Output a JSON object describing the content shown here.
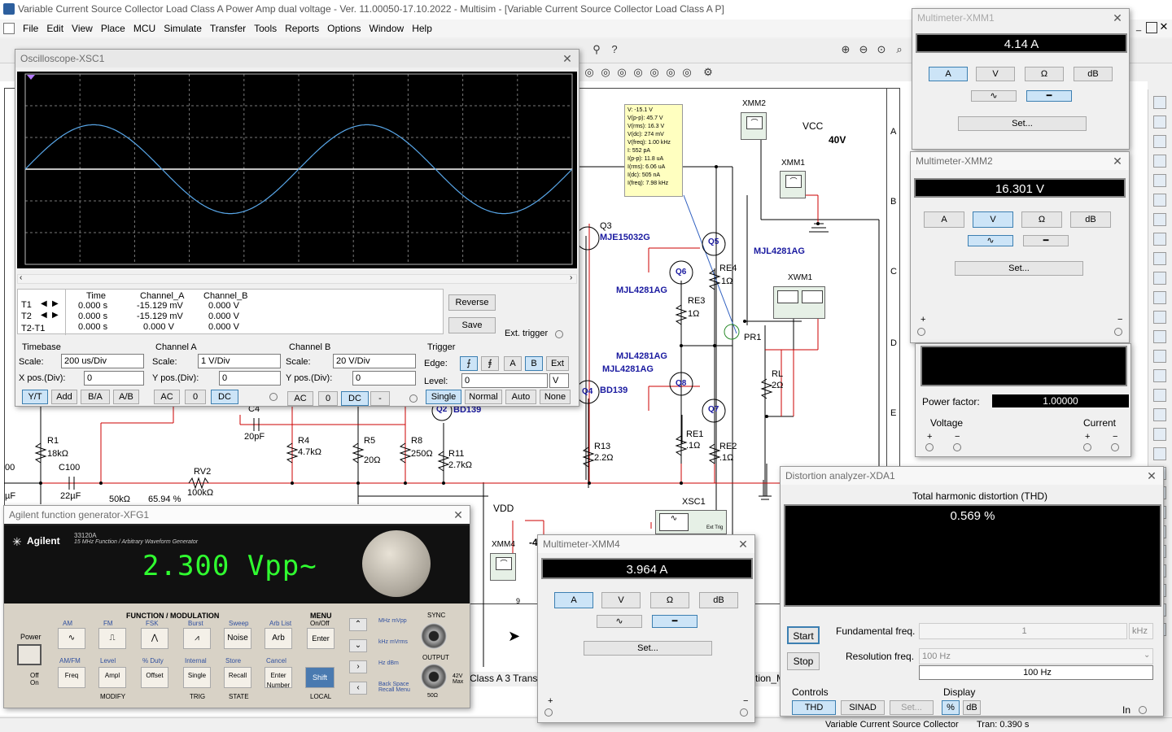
{
  "app": {
    "title": "Variable Current Source Collector Load Class A Power Amp dual voltage - Ver. 11.00050-17.10.2022 - Multisim - [Variable Current Source Collector Load Class A P]",
    "menu": [
      "File",
      "Edit",
      "View",
      "Place",
      "MCU",
      "Simulate",
      "Transfer",
      "Tools",
      "Reports",
      "Options",
      "Window",
      "Help"
    ],
    "status_doc": "Variable Current Source Collector",
    "status_tran": "Tran: 0.390 s",
    "tab1": "Class A 3 Transis",
    "tab2": "tion_M",
    "selected_tab_icon": "scissors-icon"
  },
  "probe": {
    "lines": [
      "V: -15.1 V",
      "V(p-p): 45.7 V",
      "V(rms): 16.3 V",
      "V(dc): 274 mV",
      "V(freq): 1.00 kHz",
      "I: 552 pA",
      "I(p-p): 11.8 uA",
      "I(rms): 6.06 uA",
      "I(dc): 505 nA",
      "I(freq): 7.98 kHz"
    ]
  },
  "schematic": {
    "labels": {
      "xmm2": "XMM2",
      "vcc": "VCC",
      "v40": "40V",
      "xmm1": "XMM1",
      "q3": "Q3",
      "q3_part": "MJE15032G",
      "q5": "Q5",
      "q6": "Q6",
      "mjl1": "MJL4281AG",
      "mjl2": "MJL4281AG",
      "mjl3": "MJL4281AG",
      "mjl4": "MJL4281AG",
      "re4": "RE4",
      "re4v": "1Ω",
      "re3": "RE3",
      "re3v": "1Ω",
      "xwm1": "XWM1",
      "pr1": "PR1",
      "rl": "RL",
      "rlv": "2Ω",
      "q4": "Q4",
      "q4_part": "BD139",
      "q8": "Q8",
      "q7": "Q7",
      "q2": "Q2",
      "q2_part": "BD139",
      "re1": "RE1",
      "re1v": ".1Ω",
      "re2": "RE2",
      "re2v": ".1Ω",
      "r13": "R13",
      "r13v": "2.2Ω",
      "r1": "R1",
      "r1v": "18kΩ",
      "c100": "C100",
      "c100v": "22µF",
      "c4": "C4",
      "c4v": "20pF",
      "r4": "R4",
      "r4v": "4.7kΩ",
      "r5": "R5",
      "r5v": "20Ω",
      "r8": "R8",
      "r8v": "250Ω",
      "r11": "R11",
      "r11v": "2.7kΩ",
      "rv2": "RV2",
      "rv2v": "100kΩ",
      "pot50": "50kΩ",
      "pct": "65.94 %",
      "xsc1": "XSC1",
      "vdd": "VDD",
      "xmm4": "XMM4",
      "row_a": "A",
      "row_b": "B",
      "row_c": "C",
      "row_d": "D",
      "row_e": "E",
      "col9": "9",
      "left00": "00",
      "leftuF": "µF",
      "neg4": "-4",
      "ext_trig": "Ext Trig"
    }
  },
  "oscilloscope": {
    "title": "Oscilloscope-XSC1",
    "cols": [
      "Time",
      "Channel_A",
      "Channel_B"
    ],
    "rows": [
      {
        "name": "T1",
        "time": "0.000 s",
        "a": "-15.129 mV",
        "b": "0.000 V"
      },
      {
        "name": "T2",
        "time": "0.000 s",
        "a": "-15.129 mV",
        "b": "0.000 V"
      },
      {
        "name": "T2-T1",
        "time": "0.000 s",
        "a": "0.000 V",
        "b": "0.000 V"
      }
    ],
    "reverse": "Reverse",
    "save": "Save",
    "ext_trigger": "Ext. trigger",
    "timebase": {
      "title": "Timebase",
      "scale_label": "Scale:",
      "scale": "200 us/Div",
      "xpos_label": "X pos.(Div):",
      "xpos": "0",
      "modes": [
        "Y/T",
        "Add",
        "B/A",
        "A/B"
      ]
    },
    "chA": {
      "title": "Channel A",
      "scale_label": "Scale:",
      "scale": "1  V/Div",
      "ypos_label": "Y pos.(Div):",
      "ypos": "0",
      "coupling": [
        "AC",
        "0",
        "DC"
      ]
    },
    "chB": {
      "title": "Channel B",
      "scale_label": "Scale:",
      "scale": "20  V/Div",
      "ypos_label": "Y pos.(Div):",
      "ypos": "0",
      "coupling": [
        "AC",
        "0",
        "DC",
        "-"
      ]
    },
    "trigger": {
      "title": "Trigger",
      "edge_label": "Edge:",
      "sources": [
        "A",
        "B",
        "Ext"
      ],
      "level_label": "Level:",
      "level": "0",
      "level_unit": "V",
      "modes": [
        "Single",
        "Normal",
        "Auto",
        "None"
      ]
    },
    "waveform": {
      "amplitude_div": 1.4,
      "cycles": 2.0,
      "phase_deg": 0
    }
  },
  "xmm1": {
    "title": "Multimeter-XMM1",
    "value": "4.14 A",
    "modes": [
      "A",
      "V",
      "Ω",
      "dB"
    ],
    "set": "Set...",
    "mode_sel": "A",
    "ac_dc_sel": "dc"
  },
  "xmm2": {
    "title": "Multimeter-XMM2",
    "value": "16.301 V",
    "modes": [
      "A",
      "V",
      "Ω",
      "dB"
    ],
    "set": "Set...",
    "mode_sel": "V",
    "ac_dc_sel": "ac"
  },
  "xmm4": {
    "title": "Multimeter-XMM4",
    "value": "3.964 A",
    "modes": [
      "A",
      "V",
      "Ω",
      "dB"
    ],
    "set": "Set...",
    "mode_sel": "A",
    "ac_dc_sel": "dc"
  },
  "wattmeter": {
    "power_factor_label": "Power factor:",
    "power_factor": "1.00000",
    "voltage": "Voltage",
    "current": "Current",
    "plus": "+",
    "minus": "−"
  },
  "distortion": {
    "title": "Distortion analyzer-XDA1",
    "heading": "Total harmonic distortion (THD)",
    "value": "0.569 %",
    "start": "Start",
    "stop": "Stop",
    "fund_label": "Fundamental freq.",
    "fund": "1",
    "fund_unit": "kHz",
    "res_label": "Resolution freq.",
    "res": "100 Hz",
    "res_value": "100 Hz",
    "controls": "Controls",
    "thd": "THD",
    "sinad": "SINAD",
    "set": "Set...",
    "display": "Display",
    "pct": "%",
    "db": "dB",
    "in": "In"
  },
  "fgen": {
    "title": "Agilent function generator-XFG1",
    "brand": "Agilent",
    "model": "33120A",
    "subtitle": "15 MHz Function / Arbitrary Waveform Generator",
    "display": "2.300 Vpp~",
    "function_label": "FUNCTION / MODULATION",
    "menu_label": "MENU",
    "onoff": "On/Off",
    "top_labels": [
      "AM",
      "FM",
      "FSK",
      "Burst",
      "Sweep",
      "Arb List"
    ],
    "row1": [
      "∿",
      "⎍",
      "⋀",
      "⩘",
      "Noise",
      "Arb"
    ],
    "row2_labels": [
      "AM/FM",
      "Level",
      "% Duty",
      "Internal",
      "Store",
      "Cancel"
    ],
    "row2": [
      "Freq",
      "Ampl",
      "Offset",
      "Single",
      "Recall",
      "Enter Number"
    ],
    "enter": "Enter",
    "shift": "Shift",
    "modify": "MODIFY",
    "trig": "TRIG",
    "state": "STATE",
    "local": "LOCAL",
    "power": "Power",
    "off": "Off",
    "on": "On",
    "sync": "SYNC",
    "output": "OUTPUT",
    "maxv": "42V Max",
    "ohm": "50Ω",
    "units": [
      "MHz mVpp",
      "kHz mVrms",
      "Hz dBm",
      "Back Space Recall Menu"
    ]
  }
}
